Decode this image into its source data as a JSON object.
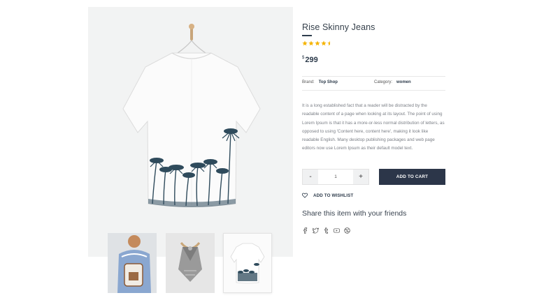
{
  "product": {
    "title": "Rise Skinny Jeans",
    "rating": 4.5,
    "rating_max": 5,
    "star_color": "#f5b301",
    "currency": "$",
    "price": "299",
    "brand_label": "Brand:",
    "brand_value": "Top Shop",
    "category_label": "Category:",
    "category_value": "women",
    "description": "It is a long established fact that a reader will be distracted by the readable content of a page when looking at its layout. The point of using Lorem Ipsum is that it has a more-or-less normal distribution of letters, as opposed to using 'Content here, content here', making it look like readable English. Many desktop publishing packages and web page editors now use Lorem Ipsum as their default model text."
  },
  "gallery": {
    "main_image": "white-shirt-palm-print",
    "thumbnails": [
      "backpack-photo",
      "scarf-photo",
      "white-shirt-palm-print"
    ],
    "selected_thumbnail": 2
  },
  "purchase": {
    "minus_label": "-",
    "quantity": "1",
    "plus_label": "+",
    "add_to_cart_label": "ADD TO CART",
    "wishlist_label": "ADD TO WISHLIST",
    "accent_color": "#2c3649"
  },
  "share": {
    "title": "Share this item with your friends",
    "icons": [
      "facebook-icon",
      "twitter-icon",
      "tumblr-icon",
      "youtube-icon",
      "dribbble-icon"
    ]
  }
}
